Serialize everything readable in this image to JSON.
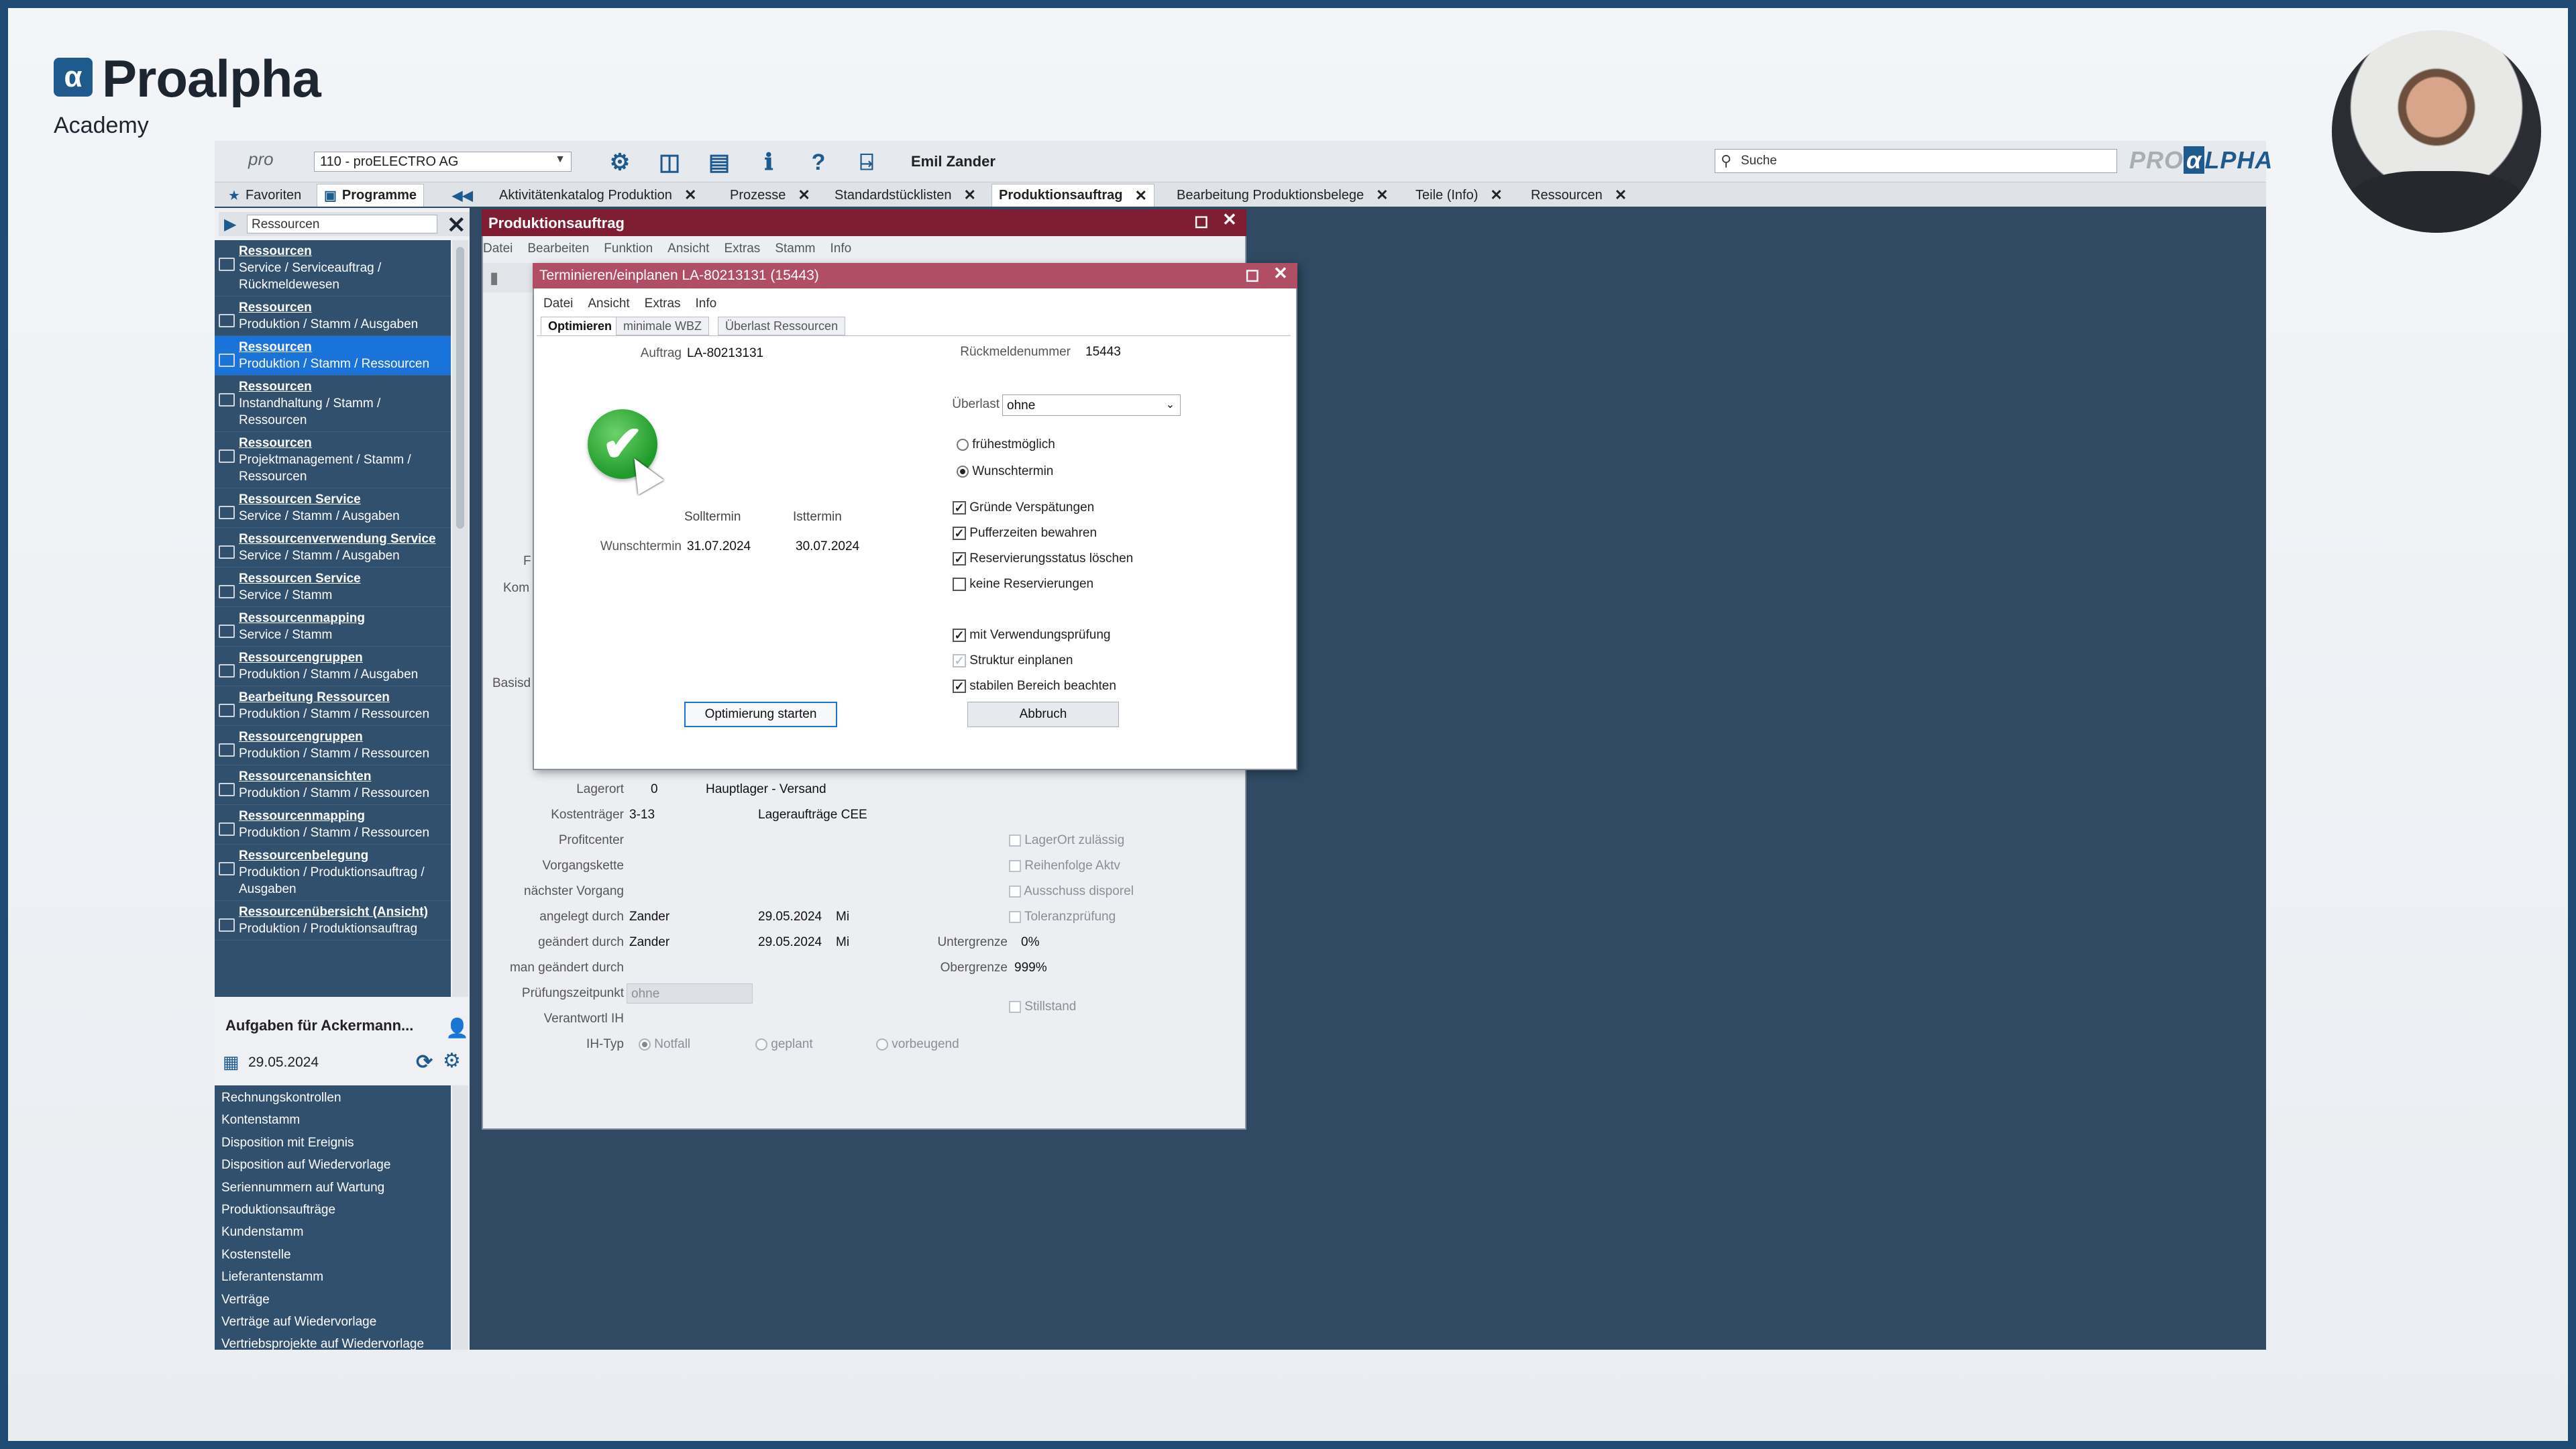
{
  "brand": {
    "logo_letter": "α",
    "name": "Proalpha",
    "sub": "Academy"
  },
  "toolbar": {
    "pro_label": "pro",
    "company": "110 - proELECTRO AG",
    "user": "Emil Zander",
    "search_placeholder": "Suche",
    "brand_left": "PRO",
    "brand_mid": "α",
    "brand_right": "LPHA"
  },
  "tabs": [
    {
      "label": "Favoriten"
    },
    {
      "label": "Programme"
    },
    {
      "label": "Aktivitätenkatalog Produktion"
    },
    {
      "label": "Prozesse"
    },
    {
      "label": "Standardstücklisten"
    },
    {
      "label": "Produktionsauftrag"
    },
    {
      "label": "Bearbeitung Produktionsbelege"
    },
    {
      "label": "Teile (Info)"
    },
    {
      "label": "Ressourcen"
    }
  ],
  "sidebar": {
    "search_value": "Ressourcen",
    "results": [
      {
        "title": "Ressourcen",
        "path": "Service / Serviceauftrag / Rückmeldewesen"
      },
      {
        "title": "Ressourcen",
        "path": "Produktion / Stamm / Ausgaben"
      },
      {
        "title": "Ressourcen",
        "path": "Produktion / Stamm / Ressourcen"
      },
      {
        "title": "Ressourcen",
        "path": "Instandhaltung / Stamm / Ressourcen"
      },
      {
        "title": "Ressourcen",
        "path": "Projektmanagement / Stamm / Ressourcen"
      },
      {
        "title": "Ressourcen Service",
        "path": "Service / Stamm / Ausgaben"
      },
      {
        "title": "Ressourcenverwendung Service",
        "path": "Service / Stamm / Ausgaben"
      },
      {
        "title": "Ressourcen Service",
        "path": "Service / Stamm"
      },
      {
        "title": "Ressourcenmapping",
        "path": "Service / Stamm"
      },
      {
        "title": "Ressourcengruppen",
        "path": "Produktion / Stamm / Ausgaben"
      },
      {
        "title": "Bearbeitung Ressourcen",
        "path": "Produktion / Stamm / Ressourcen"
      },
      {
        "title": "Ressourcengruppen",
        "path": "Produktion / Stamm / Ressourcen"
      },
      {
        "title": "Ressourcenansichten",
        "path": "Produktion / Stamm / Ressourcen"
      },
      {
        "title": "Ressourcenmapping",
        "path": "Produktion / Stamm / Ressourcen"
      },
      {
        "title": "Ressourcenbelegung",
        "path": "Produktion / Produktionsauftrag / Ausgaben"
      },
      {
        "title": "Ressourcenübersicht (Ansicht)",
        "path": "Produktion / Produktionsauftrag"
      }
    ],
    "tasks_title": "Aufgaben für Ackermann...",
    "tasks_date": "29.05.2024",
    "tasks": [
      "Rechnungskontrollen",
      "Kontenstamm",
      "Disposition mit Ereignis",
      "Disposition auf Wiedervorlage",
      "Seriennummern auf Wartung",
      "Produktionsaufträge",
      "Kundenstamm",
      "Kostenstelle",
      "Lieferantenstamm",
      "Verträge",
      "Verträge auf Wiedervorlage",
      "Vertriebsprojekte auf Wiedervorlage"
    ]
  },
  "pa_window": {
    "title": "Produktionsauftrag",
    "menu": [
      "Datei",
      "Bearbeiten",
      "Funktion",
      "Ansicht",
      "Extras",
      "Stamm",
      "Info"
    ],
    "partial_labels": {
      "f": "F",
      "kom": "Kom",
      "basis": "Basisd"
    },
    "lagerort_label": "Lagerort",
    "lagerort_value": "0",
    "lagerort_name": "Hauptlager - Versand",
    "kostentraeger_label": "Kostenträger",
    "kostentraeger_value": "3-13",
    "kostentraeger_name": "Lageraufträge CEE",
    "profitcenter_label": "Profitcenter",
    "vorgangskette_label": "Vorgangskette",
    "naechster_label": "nächster Vorgang",
    "angelegt_label": "angelegt durch",
    "angelegt_user": "Zander",
    "angelegt_date": "29.05.2024",
    "angelegt_day": "Mi",
    "geaendert_label": "geändert durch",
    "geaendert_user": "Zander",
    "geaendert_date": "29.05.2024",
    "geaendert_day": "Mi",
    "man_geaendert_label": "man geändert durch",
    "pruefung_label": "Prüfungszeitpunkt",
    "pruefung_value": "ohne",
    "verantwortl_label": "Verantwortl IH",
    "ihtyp_label": "IH-Typ",
    "ihtyp_options": [
      "Notfall",
      "geplant",
      "vorbeugend"
    ],
    "lagerort_zul": "LagerOrt zulässig",
    "reihenfolge": "Reihenfolge Aktv",
    "ausschuss": "Ausschuss disporel",
    "toleranz": "Toleranzprüfung",
    "untergrenze_label": "Untergrenze",
    "untergrenze_value": "0%",
    "obergrenze_label": "Obergrenze",
    "obergrenze_value": "999%",
    "stillstand": "Stillstand"
  },
  "dialog": {
    "title": "Terminieren/einplanen  LA-80213131 (15443)",
    "menu": [
      "Datei",
      "Ansicht",
      "Extras",
      "Info"
    ],
    "tabs": [
      "Optimieren",
      "minimale WBZ",
      "Überlast Ressourcen"
    ],
    "auftrag_label": "Auftrag",
    "auftrag_value": "LA-80213131",
    "rueck_label": "Rückmeldenummer",
    "rueck_value": "15443",
    "ueberlast_label": "Überlast",
    "ueberlast_value": "ohne",
    "radio_frueh": "frühestmöglich",
    "radio_wunsch": "Wunschtermin",
    "soll_header": "Solltermin",
    "ist_header": "Isttermin",
    "wunsch_row_label": "Wunschtermin",
    "soll_value": "31.07.2024",
    "ist_value": "30.07.2024",
    "options": [
      {
        "label": "Gründe Verspätungen",
        "checked": true
      },
      {
        "label": "Pufferzeiten bewahren",
        "checked": true
      },
      {
        "label": "Reservierungsstatus löschen",
        "checked": true
      },
      {
        "label": "keine Reservierungen",
        "checked": false
      },
      {
        "label": "mit Verwendungsprüfung",
        "checked": true
      },
      {
        "label": "Struktur einplanen",
        "checked": true
      },
      {
        "label": "stabilen Bereich beachten",
        "checked": true
      }
    ],
    "btn_start": "Optimierung starten",
    "btn_cancel": "Abbruch"
  },
  "colors": {
    "frame": "#1f4a73",
    "app_bg": "#2f4a62",
    "sidebar_list": "#31506e",
    "selected": "#1a73d9",
    "pa_title": "#7f1d32",
    "dialog_title": "#b04e66",
    "success": "#1f9a2b"
  }
}
